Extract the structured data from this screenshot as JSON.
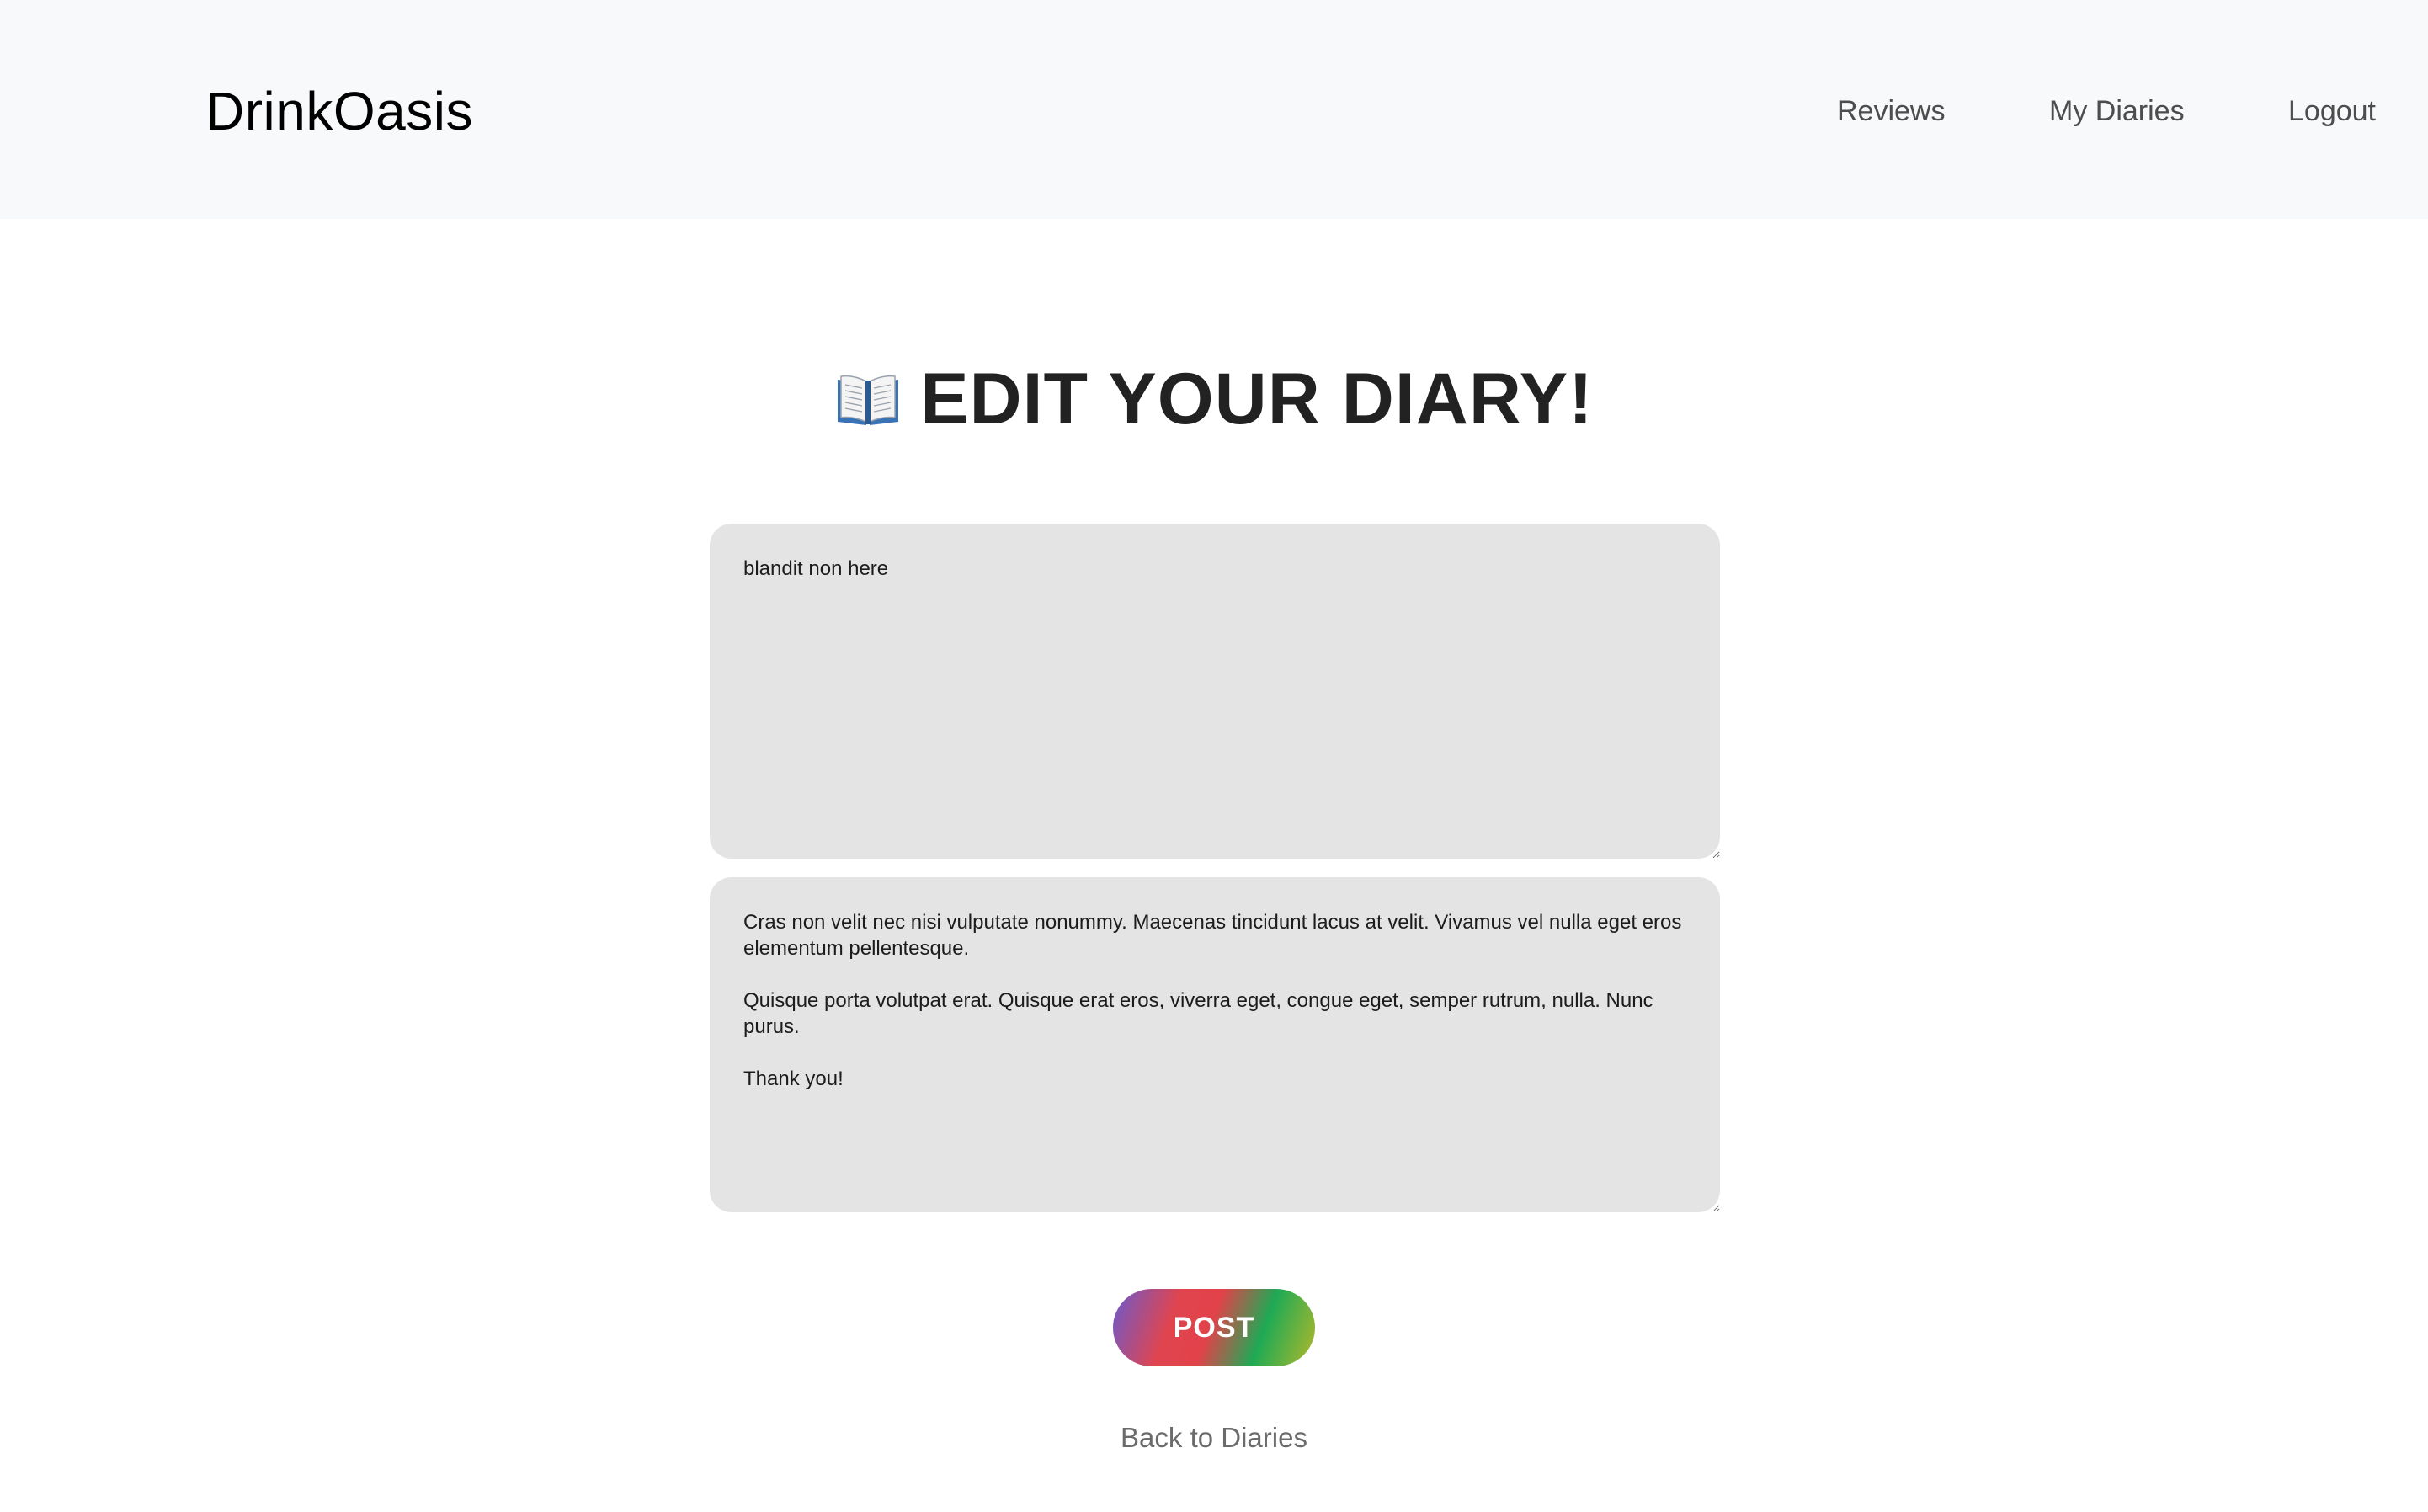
{
  "navbar": {
    "brand": "DrinkOasis",
    "links": [
      {
        "label": "Reviews"
      },
      {
        "label": "My Diaries"
      },
      {
        "label": "Logout"
      }
    ]
  },
  "main": {
    "title_icon": "open-book-icon",
    "title": "EDIT YOUR DIARY!",
    "title_field_value": "blandit non here",
    "body_field_value": "Cras non velit nec nisi vulputate nonummy. Maecenas tincidunt lacus at velit. Vivamus vel nulla eget eros elementum pellentesque.\n\nQuisque porta volutpat erat. Quisque erat eros, viverra eget, congue eget, semper rutrum, nulla. Nunc purus.\n\nThank you!",
    "post_label": "POST",
    "back_link": "Back to Diaries"
  },
  "colors": {
    "navbar_bg": "#f8f9fa",
    "field_bg": "#e4e4e4",
    "button_gradient": [
      "#6a5acd",
      "#e0454f",
      "#1eaa55",
      "#b3b82a"
    ]
  }
}
